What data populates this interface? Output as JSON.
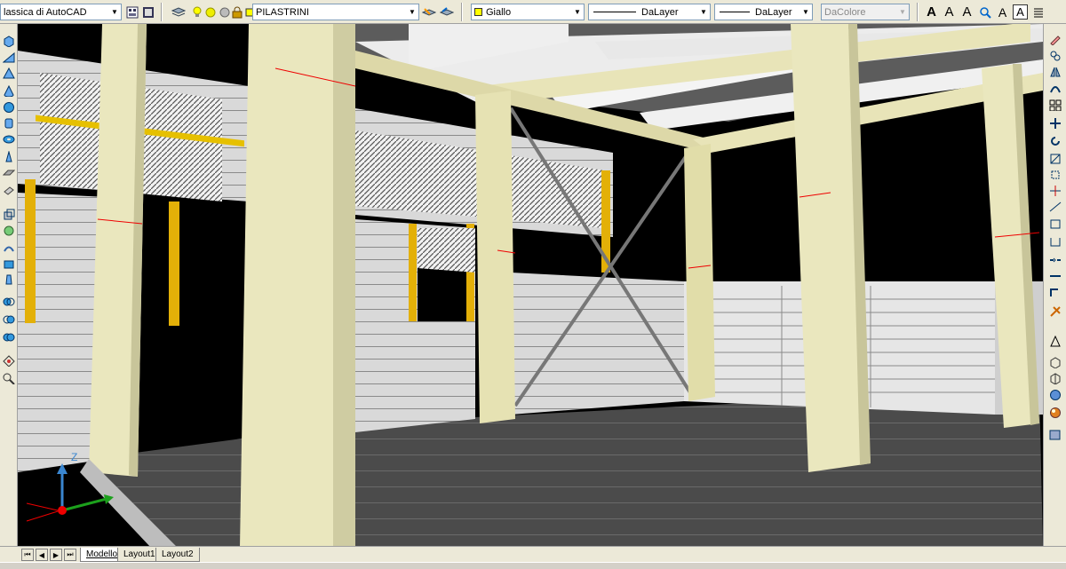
{
  "toolbar": {
    "workspace": "lassica di AutoCAD",
    "layer": "PILASTRINI",
    "color": "Giallo",
    "linetype": "DaLayer",
    "lineweight": "DaLayer",
    "plotstyle": "DaColore",
    "text_icons": [
      "A",
      "A",
      "A",
      "A",
      "A"
    ],
    "icon_names": [
      "workspace-settings-icon",
      "workspace-toggle-icon",
      "layer-manager-icon",
      "bulb-on-icon",
      "sun-icon",
      "freeze-icon",
      "lock-icon",
      "layer-previous-icon",
      "layer-make-current-icon"
    ],
    "colors": {
      "yellow": "#ffff00"
    }
  },
  "left_tools": {
    "icon_names": [
      "box-icon",
      "wedge-icon",
      "pyramid-icon",
      "cone-icon",
      "sphere-icon",
      "cylinder-icon",
      "torus-icon",
      "polysolid-icon",
      "planar-surface-icon",
      "extrude-icon",
      "revolve-icon",
      "sweep-icon",
      "loft-icon",
      "presspull-icon",
      "union-icon",
      "subtract-icon",
      "intersect-icon",
      "orbit-icon",
      "help-icon"
    ]
  },
  "right_tools": {
    "icon_names": [
      "erase-icon",
      "copy-icon",
      "mirror-icon",
      "offset-icon",
      "array-icon",
      "move-icon",
      "rotate-icon",
      "scale-icon",
      "stretch-icon",
      "trim-icon",
      "extend-icon",
      "break-icon",
      "join-icon",
      "chamfer-icon",
      "fillet-icon",
      "explode-icon",
      "text-icon",
      "3d-box-icon",
      "3d-wire-icon",
      "material-icon",
      "render-icon",
      "visual-style-icon"
    ]
  },
  "viewport": {
    "ucs_z": "Z"
  },
  "tabs": {
    "model": "Modello",
    "layout1": "Layout1",
    "layout2": "Layout2",
    "nav": [
      "⏮",
      "◀",
      "▶",
      "⏭"
    ]
  }
}
